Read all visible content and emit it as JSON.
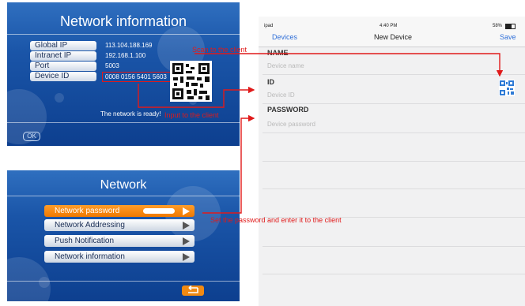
{
  "network_info_panel": {
    "title": "Network information",
    "rows": [
      {
        "label": "Global IP",
        "value": "113.104.188.169"
      },
      {
        "label": "Intranet IP",
        "value": "192.168.1.100"
      },
      {
        "label": "Port",
        "value": "5003"
      },
      {
        "label": "Device ID",
        "value": "0008 0156 5401 5603"
      }
    ],
    "status": "The network is ready!",
    "ok_label": "OK"
  },
  "network_menu_panel": {
    "title": "Network",
    "items": [
      {
        "label": "Network password"
      },
      {
        "label": "Network Addressing"
      },
      {
        "label": "Push Notification"
      },
      {
        "label": "Network information"
      }
    ]
  },
  "annotations": {
    "scan": "Scan to the client",
    "input": "Input to the client",
    "password": "Set the password and enter it to the client"
  },
  "ipad": {
    "status_left": "ipad",
    "status_time": "4:40 PM",
    "status_battery": "58%",
    "nav_back": "Devices",
    "nav_title": "New Device",
    "nav_save": "Save",
    "name_label": "NAME",
    "name_placeholder": "Device name",
    "id_label": "ID",
    "id_placeholder": "Device ID",
    "password_label": "PASSWORD",
    "password_placeholder": "Device password"
  },
  "colors": {
    "panel_blue": "#1a55a8",
    "highlight_orange": "#f07800",
    "annotation_red": "#e01a1a",
    "ios_blue": "#2f6fd8"
  }
}
